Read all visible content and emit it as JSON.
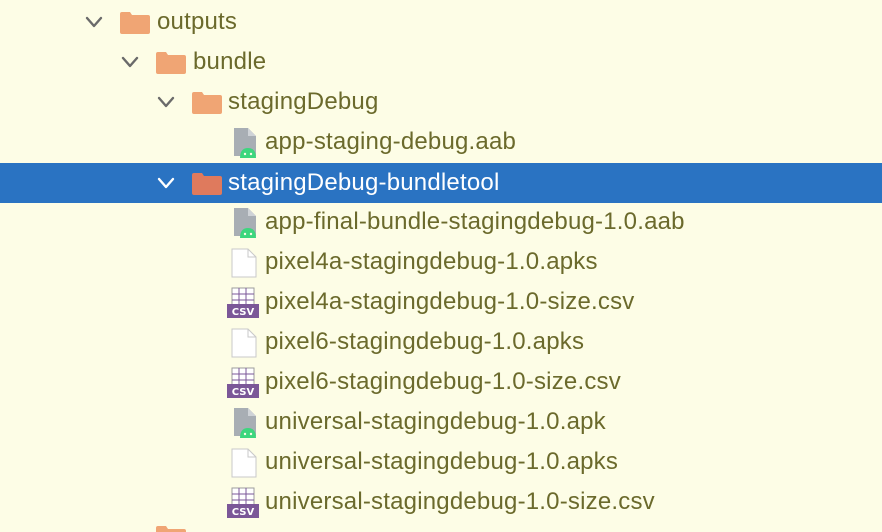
{
  "tree": {
    "rows": [
      {
        "label": "outputs",
        "type": "folder",
        "expanded": true
      },
      {
        "label": "bundle",
        "type": "folder",
        "expanded": true
      },
      {
        "label": "stagingDebug",
        "type": "folder",
        "expanded": true
      },
      {
        "label": "app-staging-debug.aab",
        "type": "android-bundle-file"
      },
      {
        "label": "stagingDebug-bundletool",
        "type": "folder",
        "expanded": true,
        "selected": true
      },
      {
        "label": "app-final-bundle-stagingdebug-1.0.aab",
        "type": "android-bundle-file"
      },
      {
        "label": "pixel4a-stagingdebug-1.0.apks",
        "type": "generic-file"
      },
      {
        "label": "pixel4a-stagingdebug-1.0-size.csv",
        "type": "csv-file"
      },
      {
        "label": "pixel6-stagingdebug-1.0.apks",
        "type": "generic-file"
      },
      {
        "label": "pixel6-stagingdebug-1.0-size.csv",
        "type": "csv-file"
      },
      {
        "label": "universal-stagingdebug-1.0.apk",
        "type": "android-bundle-file"
      },
      {
        "label": "universal-stagingdebug-1.0.apks",
        "type": "generic-file"
      },
      {
        "label": "universal-stagingdebug-1.0-size.csv",
        "type": "csv-file"
      }
    ]
  },
  "icons": {
    "folder": "folder-icon",
    "generic-file": "file-icon",
    "csv-file": "csv-file-icon",
    "android-bundle-file": "android-file-icon",
    "chevron": "chevron-down-icon"
  },
  "colors": {
    "background": "#fdfde6",
    "selection": "#2a73c2",
    "text": "#6b6a2c",
    "selected_text": "#ffffff",
    "folder": "#f0a574",
    "folder_selected": "#df7a5d",
    "csv_badge": "#7b5798",
    "android_green": "#3dd67e",
    "file_gray": "#a8aeb4"
  },
  "csv_badge_text": "CSV"
}
